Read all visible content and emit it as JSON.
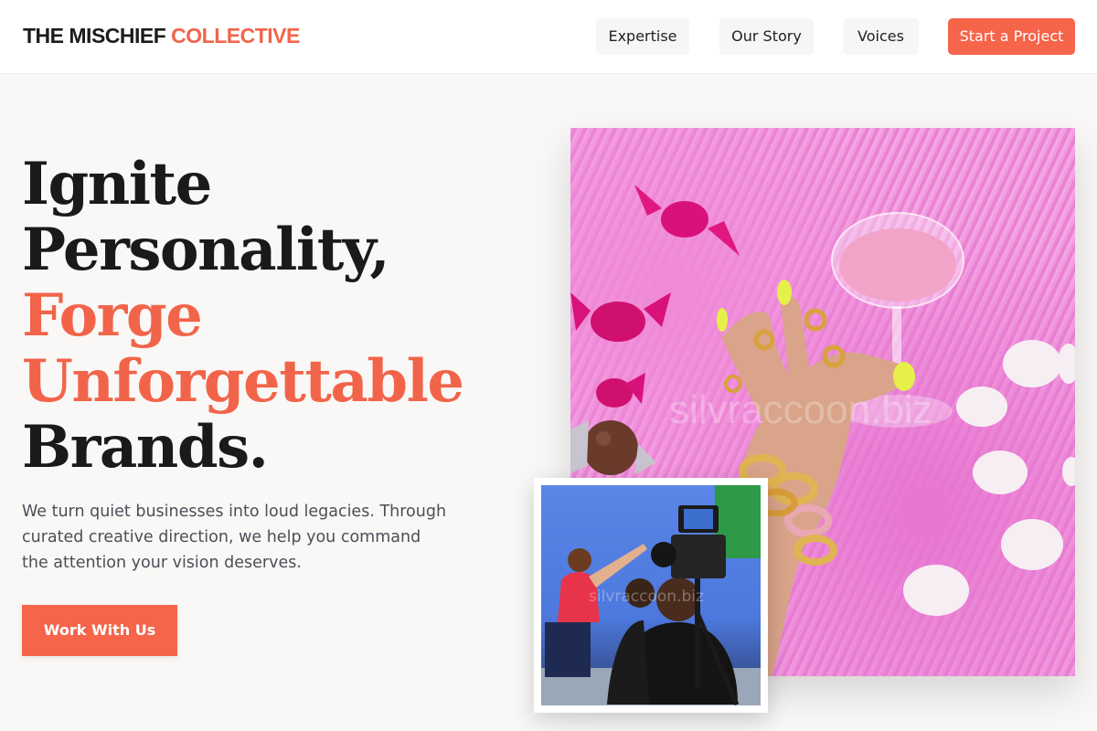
{
  "brand": {
    "name_primary": "THE MISCHIEF",
    "name_accent": "COLLECTIVE",
    "accent_color": "#f2644a"
  },
  "nav": {
    "items": [
      {
        "label": "Expertise"
      },
      {
        "label": "Our Story"
      },
      {
        "label": "Voices"
      }
    ],
    "cta_label": "Start a Project"
  },
  "hero": {
    "headline_lines": [
      {
        "text": "Ignite",
        "style": "dark"
      },
      {
        "text": "Personality,",
        "style": "dark"
      },
      {
        "text": "Forge",
        "style": "accent"
      },
      {
        "text": "Unforgettable",
        "style": "accent"
      },
      {
        "text": "Brands.",
        "style": "dark"
      }
    ],
    "subtext": "We turn quiet businesses into loud legacies. Through curated creative direction, we help you command the attention your vision deserves.",
    "cta_label": "Work With Us"
  },
  "images": {
    "main": {
      "subject": "hand-with-gold-jewelry-and-cocktail-on-pink-fur",
      "watermark": "silvraccoon.biz"
    },
    "inset": {
      "subject": "film-crew-camera-shoot",
      "watermark": "silvraccoon.biz"
    }
  }
}
